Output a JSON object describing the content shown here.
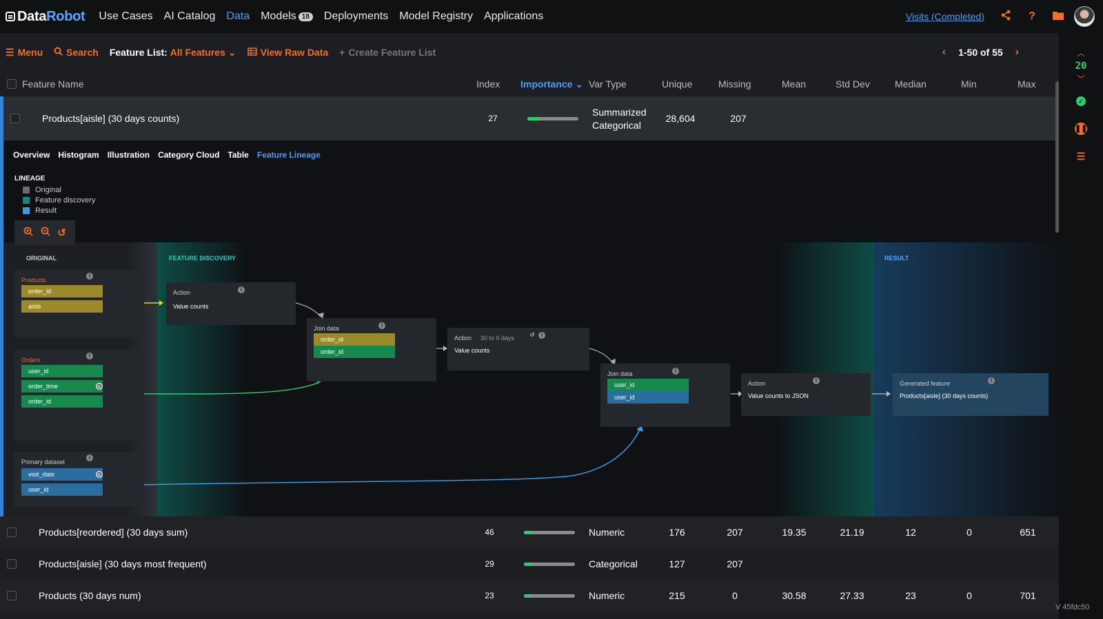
{
  "nav": {
    "logo_data": "Data",
    "logo_robot": "Robot",
    "items": [
      {
        "label": "Use Cases"
      },
      {
        "label": "AI Catalog"
      },
      {
        "label": "Data"
      },
      {
        "label": "Models",
        "badge": "18"
      },
      {
        "label": "Deployments"
      },
      {
        "label": "Model Registry"
      },
      {
        "label": "Applications"
      }
    ],
    "active": "Data",
    "visits_label": "Visits (Completed)"
  },
  "toolbar": {
    "menu": "Menu",
    "search": "Search",
    "feature_list_label": "Feature List:",
    "feature_list_value": "All Features",
    "view_raw": "View Raw Data",
    "create_list": "Create Feature List",
    "pager": "1-50 of 55"
  },
  "table": {
    "headers": {
      "name": "Feature Name",
      "index": "Index",
      "importance": "Importance",
      "var_type": "Var Type",
      "unique": "Unique",
      "missing": "Missing",
      "mean": "Mean",
      "std": "Std Dev",
      "median": "Median",
      "min": "Min",
      "max": "Max"
    },
    "expanded_row": {
      "name": "Products[aisle] (30 days counts)",
      "index": "27",
      "importance": 0.22,
      "var_type_1": "Summarized",
      "var_type_2": "Categorical",
      "unique": "28,604",
      "missing": "207"
    },
    "rows": [
      {
        "name": "Products[reordered] (30 days sum)",
        "index": "46",
        "importance": 0.18,
        "var_type": "Numeric",
        "unique": "176",
        "missing": "207",
        "mean": "19.35",
        "std": "21.19",
        "median": "12",
        "min": "0",
        "max": "651"
      },
      {
        "name": "Products[aisle] (30 days most frequent)",
        "index": "29",
        "importance": 0.16,
        "var_type": "Categorical",
        "unique": "127",
        "missing": "207",
        "mean": "",
        "std": "",
        "median": "",
        "min": "",
        "max": ""
      },
      {
        "name": "Products (30 days num)",
        "index": "23",
        "importance": 0.14,
        "var_type": "Numeric",
        "unique": "215",
        "missing": "0",
        "mean": "30.58",
        "std": "27.33",
        "median": "23",
        "min": "0",
        "max": "701"
      }
    ]
  },
  "panel": {
    "tabs": [
      "Overview",
      "Histogram",
      "Illustration",
      "Category Cloud",
      "Table",
      "Feature Lineage"
    ],
    "active_tab": "Feature Lineage",
    "lineage_title": "LINEAGE",
    "legend": [
      {
        "label": "Original",
        "color": "#6d6d6d"
      },
      {
        "label": "Feature discovery",
        "color": "#138a7d"
      },
      {
        "label": "Result",
        "color": "#3b9be0"
      }
    ],
    "zones": {
      "original": "ORIGINAL",
      "feature_discovery": "FEATURE DISCOVERY",
      "result": "RESULT"
    },
    "datasets": {
      "products": {
        "title": "Products",
        "fields": [
          "order_id",
          "aisle"
        ]
      },
      "orders": {
        "title": "Orders",
        "fields": [
          "user_id",
          "order_time",
          "order_id"
        ]
      },
      "primary": {
        "title": "Primary dataset",
        "fields": [
          "visit_date",
          "user_id"
        ]
      }
    },
    "action1": {
      "title": "Action",
      "text": "Value counts"
    },
    "join1": {
      "title": "Join data",
      "fields": [
        "order_id",
        "order_id"
      ]
    },
    "action2": {
      "title": "Action",
      "window": "30 to 0 days",
      "text": "Value counts"
    },
    "join2": {
      "title": "Join data",
      "fields": [
        "user_id",
        "user_id"
      ]
    },
    "action3": {
      "title": "Action",
      "text": "Value counts to JSON"
    },
    "generated": {
      "title": "Generated feature",
      "text": "Products[aisle] (30 days counts)"
    }
  },
  "sidebar": {
    "worker_count": "20"
  },
  "version": "V 45fdc50",
  "colors": {
    "accent": "#f36f21",
    "link": "#4a9ff5",
    "importance": "#2ecc71"
  }
}
